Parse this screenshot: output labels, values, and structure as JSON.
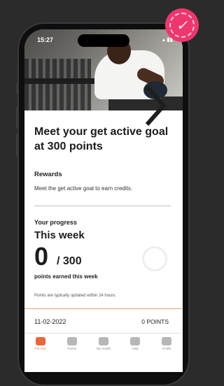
{
  "status": {
    "time": "15:27",
    "icons": "▴ ▮▮"
  },
  "hero": {
    "image": "man-lifting-dumbbell-photo",
    "arrow_icon": "chevron-right-icon"
  },
  "badge": {
    "icon": "checkmark-signature-icon",
    "glyph": "✓",
    "color": "#f0366f"
  },
  "goal": {
    "title": "Meet your get active goal at 300 points",
    "rewards_heading": "Rewards",
    "rewards_text": "Meet the get active goal to earn credits."
  },
  "progress": {
    "heading": "Your progress",
    "period": "This week",
    "current": "0",
    "target": "/ 300",
    "earned_label": "points earned this week",
    "note": "Points are typically updated within 24 hours.",
    "fraction": 0
  },
  "summary": {
    "date": "11-02-2022",
    "points": "0 POINTS"
  },
  "tabbar": {
    "items": [
      {
        "label": "For You",
        "icon": "list-icon",
        "active": true
      },
      {
        "label": "Points",
        "icon": "shield-icon",
        "active": false
      },
      {
        "label": "My Health",
        "icon": "bar-chart-icon",
        "active": false
      },
      {
        "label": "Help",
        "icon": "help-icon",
        "active": false
      },
      {
        "label": "Profile",
        "icon": "person-icon",
        "active": false
      }
    ],
    "accent": "#e8673a"
  }
}
